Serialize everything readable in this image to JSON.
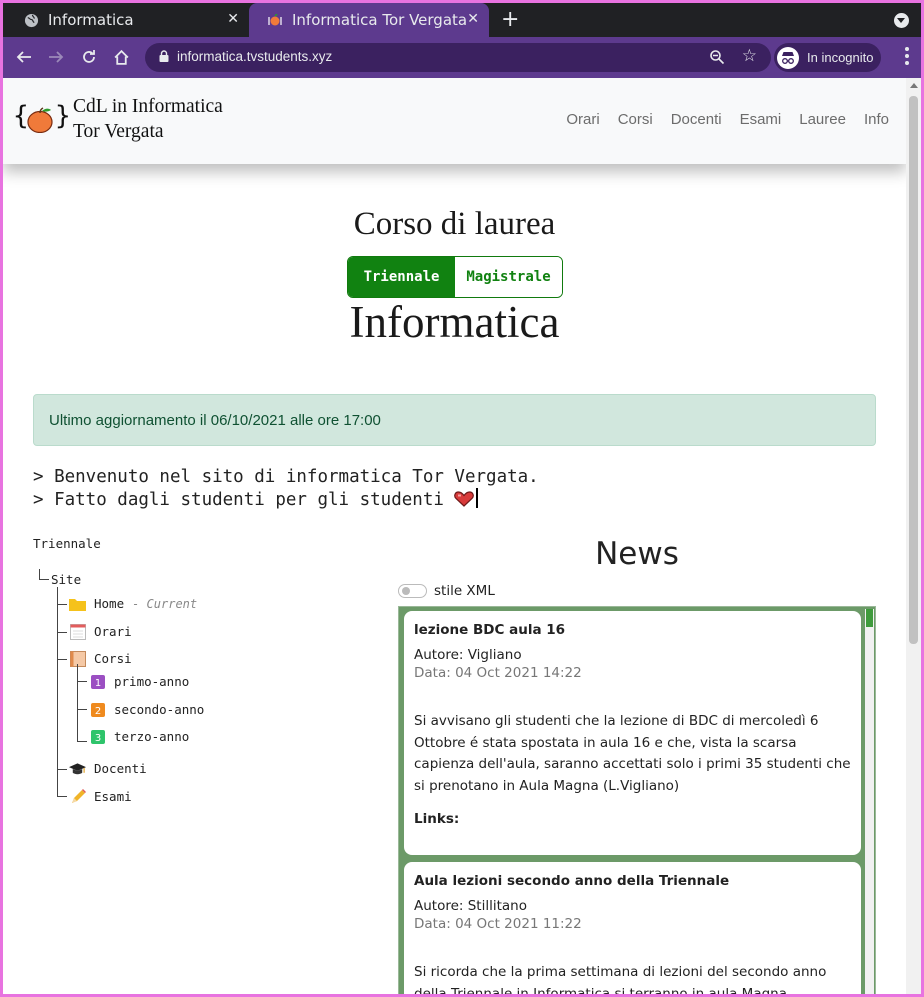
{
  "browser": {
    "tabs": [
      {
        "title": "Informatica"
      },
      {
        "title": "Informatica Tor Vergata"
      }
    ],
    "url": "informatica.tvstudents.xyz",
    "incognito_label": "In incognito"
  },
  "header": {
    "brand_line1": "CdL in Informatica",
    "brand_line2": "Tor Vergata",
    "brand_braces_left": "{",
    "brand_braces_right": "}",
    "nav": [
      "Orari",
      "Corsi",
      "Docenti",
      "Esami",
      "Lauree",
      "Info"
    ]
  },
  "hero": {
    "title_top": "Corso di laurea",
    "title_bottom": "Informatica",
    "toggle": {
      "active": "Triennale",
      "inactive": "Magistrale"
    }
  },
  "alert": {
    "text": "Ultimo aggiornamento il 06/10/2021 alle ore 17:00"
  },
  "terminal": {
    "line1": "> Benvenuto nel sito di informatica Tor Vergata.",
    "line2": "> Fatto dagli studenti per gli studenti "
  },
  "tree": {
    "root_label": "Triennale",
    "site": "Site",
    "home": "Home",
    "current_tag": "- Current",
    "orari": "Orari",
    "corsi": "Corsi",
    "primo": "primo-anno",
    "secondo": "secondo-anno",
    "terzo": "terzo-anno",
    "docenti": "Docenti",
    "esami": "Esami",
    "year_badges": [
      "1",
      "2",
      "3"
    ]
  },
  "news": {
    "title": "News",
    "xml_label": "stile XML",
    "items": [
      {
        "title": "lezione BDC aula 16",
        "author": "Autore: Vigliano",
        "date": "Data: 04 Oct 2021 14:22",
        "body": "Si avvisano gli studenti che la lezione di BDC di mercoledì 6 Ottobre é stata spostata in aula 16 e che, vista la scarsa capienza dell'aula, saranno accettati solo i primi 35 studenti che si prenotano in Aula Magna (L.Vigliano)",
        "links_label": "Links:"
      },
      {
        "title": "Aula lezioni secondo anno della Triennale",
        "author": "Autore: Stillitano",
        "date": "Data: 04 Oct 2021 11:22",
        "body": "Si ricorda che la prima settimana di lezioni del secondo anno della Triennale in Informatica si terranno in aula Magna."
      }
    ]
  },
  "colors": {
    "browser_dark": "#202124",
    "incognito_purple": "#5d3a8e",
    "toggle_green": "#118211",
    "alert_bg": "#d1e7dd",
    "news_bg": "#6c9a68"
  }
}
